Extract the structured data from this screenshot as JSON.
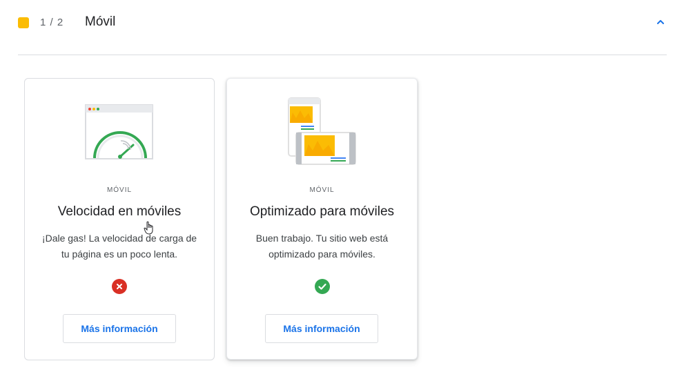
{
  "section": {
    "counter": "1 / 2",
    "title": "Móvil",
    "status_color": "#fbbc04",
    "collapse_icon": "chevron-up-icon"
  },
  "cards": [
    {
      "eyebrow": "MÓVIL",
      "title": "Velocidad en móviles",
      "description": "¡Dale gas! La velocidad de carga de tu página es un poco lenta.",
      "status": "fail",
      "status_icon": "error-x-icon",
      "status_color": "#d93025",
      "button_label": "Más información",
      "illustration": "speed-gauge-icon"
    },
    {
      "eyebrow": "MÓVIL",
      "title": "Optimizado para móviles",
      "description": "Buen trabajo. Tu sitio web está optimizado para móviles.",
      "status": "pass",
      "status_icon": "check-circle-icon",
      "status_color": "#34a853",
      "button_label": "Más información",
      "illustration": "mobile-devices-icon"
    }
  ],
  "colors": {
    "accent": "#1a73e8",
    "chart_yellow": "#fbbc04",
    "chart_orange": "#f9ab00",
    "gauge_green": "#34a853"
  }
}
